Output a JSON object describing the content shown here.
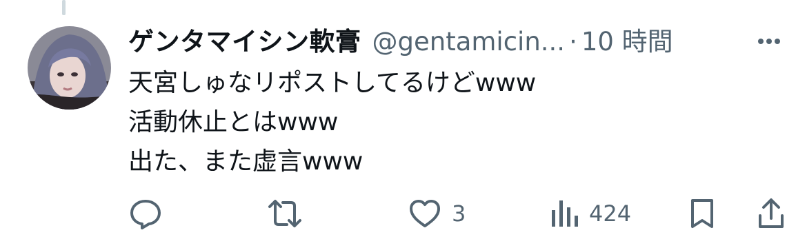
{
  "tweet": {
    "display_name": "ゲンタマイシン軟膏",
    "handle": "@gentamicin...",
    "separator": "·",
    "time": "10 時間",
    "lines": [
      "天宮しゅなリポストしてるけどwww",
      "活動休止とはwww",
      "出た、また虚言www"
    ]
  },
  "actions": {
    "reply": {
      "icon": "reply-icon"
    },
    "retweet": {
      "icon": "retweet-icon"
    },
    "like": {
      "icon": "heart-icon",
      "count": "3"
    },
    "views": {
      "icon": "views-icon",
      "count": "424"
    },
    "bookmark": {
      "icon": "bookmark-icon"
    },
    "share": {
      "icon": "share-icon"
    }
  },
  "colors": {
    "text": "#0f1419",
    "secondary": "#536471",
    "thread_line": "#cfd9de",
    "background": "#ffffff"
  }
}
